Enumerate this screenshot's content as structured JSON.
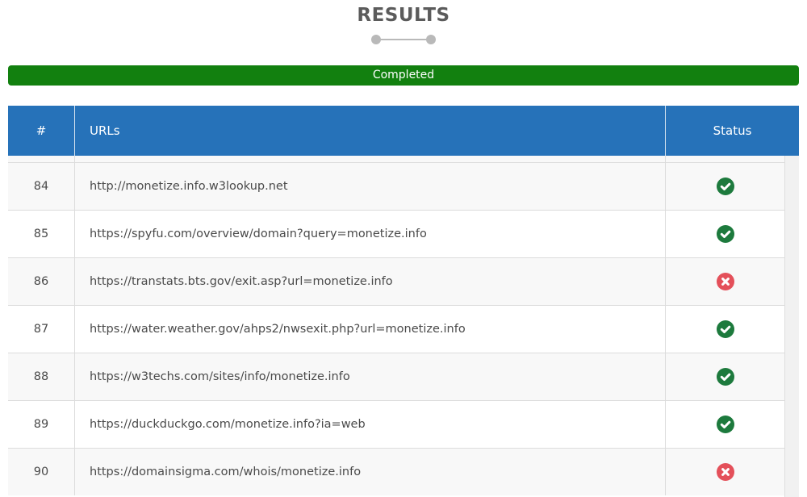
{
  "header": {
    "title": "RESULTS"
  },
  "progress": {
    "label": "Completed",
    "percent": 100,
    "color": "#12800f"
  },
  "table": {
    "columns": [
      "#",
      "URLs",
      "Status"
    ],
    "rows": [
      {
        "num": "84",
        "url": "http://monetize.info.w3lookup.net",
        "status": "success"
      },
      {
        "num": "85",
        "url": "https://spyfu.com/overview/domain?query=monetize.info",
        "status": "success"
      },
      {
        "num": "86",
        "url": "https://transtats.bts.gov/exit.asp?url=monetize.info",
        "status": "failed"
      },
      {
        "num": "87",
        "url": "https://water.weather.gov/ahps2/nwsexit.php?url=monetize.info",
        "status": "success"
      },
      {
        "num": "88",
        "url": "https://w3techs.com/sites/info/monetize.info",
        "status": "success"
      },
      {
        "num": "89",
        "url": "https://duckduckgo.com/monetize.info?ia=web",
        "status": "success"
      },
      {
        "num": "90",
        "url": "https://domainsigma.com/whois/monetize.info",
        "status": "failed"
      }
    ]
  },
  "icons": {
    "success": "check-circle-icon",
    "failed": "x-circle-icon"
  },
  "colors": {
    "header_bg": "#2672b9",
    "success": "#1d7a3d",
    "failed": "#e4505a"
  }
}
